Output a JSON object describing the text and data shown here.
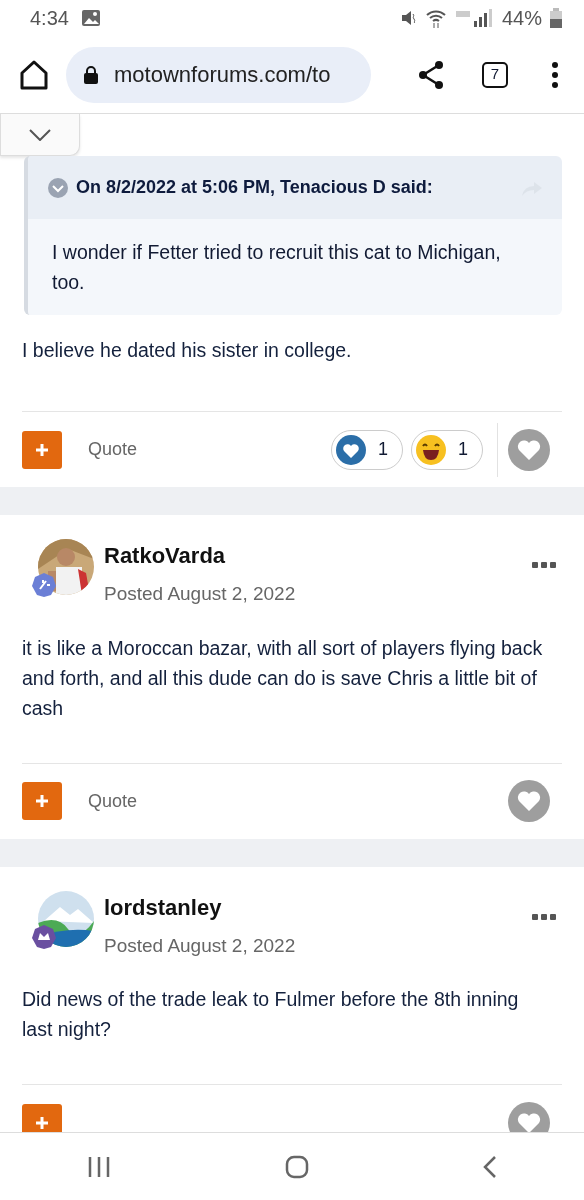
{
  "status_bar": {
    "time": "4:34",
    "battery": "44%"
  },
  "browser": {
    "url": "motownforums.com/to",
    "tab_count": "7"
  },
  "posts": [
    {
      "kind": "partial",
      "quote": {
        "header": "On 8/2/2022 at 5:06 PM, Tenacious D said:",
        "text": "I wonder if Fetter tried to recruit this cat to Michigan, too."
      },
      "body": "I believe he dated his sister in college.",
      "quote_label": "Quote",
      "reactions": [
        {
          "kind": "like",
          "count": "1"
        },
        {
          "kind": "haha",
          "count": "1"
        }
      ],
      "liked": false
    },
    {
      "kind": "full",
      "author": "RatkoVarda",
      "posted": "Posted August 2, 2022",
      "body": "it is like a Moroccan bazar, with all sort of players flying back and forth, and all this dude can do is save Chris a little bit of cash",
      "quote_label": "Quote",
      "liked": false
    },
    {
      "kind": "full",
      "author": "lordstanley",
      "posted": "Posted August 2, 2022",
      "body": "Did news of the trade leak to Fulmer before the 8th inning last night?",
      "liked": false
    }
  ]
}
